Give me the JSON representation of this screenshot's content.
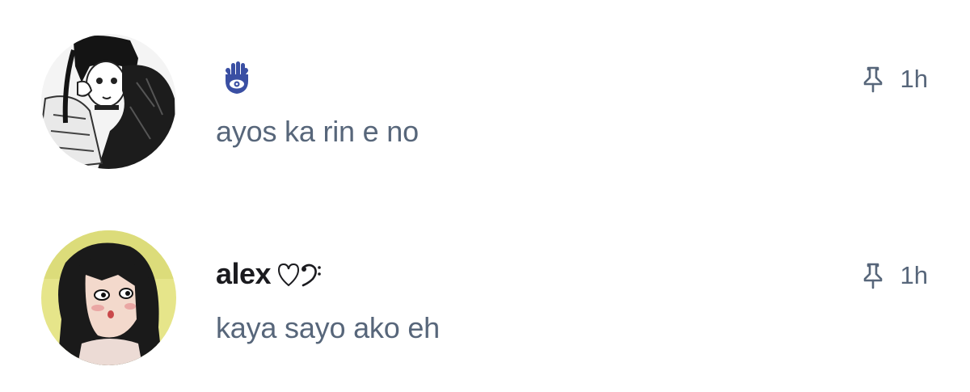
{
  "comments": [
    {
      "username": "",
      "badge_icon": "hamsa-icon",
      "text": "ayos ka rin e no",
      "time": "1h",
      "pin_icon": "pin-icon",
      "avatar": "manga-style-avatar"
    },
    {
      "username": "alex",
      "badge_icon": "heart-bass-clef-icon",
      "text": "kaya sayo ako eh",
      "time": "1h",
      "pin_icon": "pin-icon",
      "avatar": "drawn-girl-avatar"
    }
  ],
  "colors": {
    "username": "#1b1b1f",
    "body_text": "#57667a",
    "meta": "#57667a",
    "hamsa_blue": "#3a4fa3"
  }
}
